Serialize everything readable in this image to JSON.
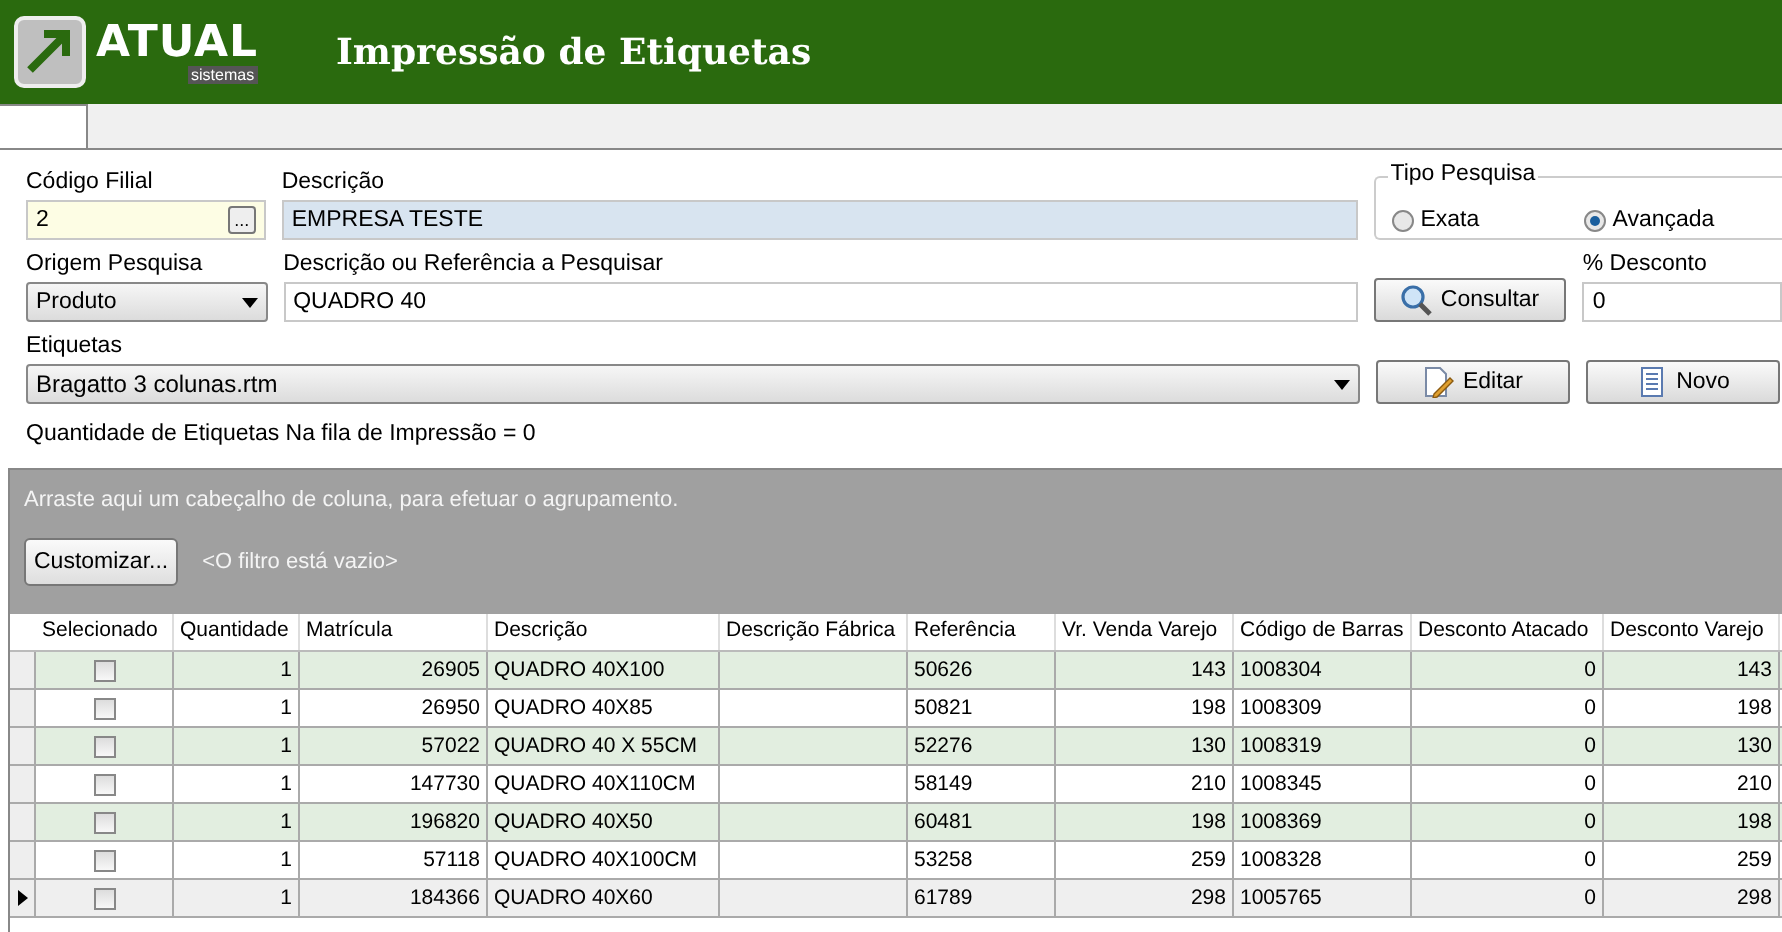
{
  "header": {
    "logo_text": "ATUAL",
    "logo_subtext": "sistemas",
    "title": "Impressão de Etiquetas"
  },
  "form": {
    "codigo_filial": {
      "label": "Código Filial",
      "value": "2",
      "button": "..."
    },
    "descricao": {
      "label": "Descrição",
      "value": "EMPRESA TESTE"
    },
    "tipo_pesquisa": {
      "label": "Tipo Pesquisa",
      "options": [
        {
          "label": "Exata",
          "selected": false
        },
        {
          "label": "Avançada",
          "selected": true
        }
      ]
    },
    "origem_pesquisa": {
      "label": "Origem Pesquisa",
      "value": "Produto"
    },
    "pesquisa": {
      "label": "Descrição ou Referência a Pesquisar",
      "value": "QUADRO 40"
    },
    "consultar_button": "Consultar",
    "desconto": {
      "label": "% Desconto",
      "value": "0"
    },
    "etiquetas": {
      "label": "Etiquetas",
      "value": "Bragatto 3 colunas.rtm"
    },
    "editar_button": "Editar",
    "novo_button": "Novo",
    "queue_text": "Quantidade de Etiquetas Na fila de Impressão = 0"
  },
  "grid": {
    "group_hint": "Arraste aqui um cabeçalho de coluna, para efetuar o agrupamento.",
    "customize_button": "Customizar...",
    "filter_text": "<O filtro está vazio>",
    "columns": [
      "Selecionado",
      "Quantidade",
      "Matrícula",
      "Descrição",
      "Descrição Fábrica",
      "Referência",
      "Vr. Venda Varejo",
      "Código de Barras",
      "Desconto Atacado",
      "Desconto Varejo"
    ],
    "rows": [
      {
        "selected": false,
        "checked": false,
        "cells": [
          "",
          "1",
          "26905",
          "QUADRO 40X100",
          "",
          "50626",
          "143",
          "1008304",
          "0",
          "143"
        ]
      },
      {
        "selected": false,
        "checked": false,
        "cells": [
          "",
          "1",
          "26950",
          "QUADRO 40X85",
          "",
          "50821",
          "198",
          "1008309",
          "0",
          "198"
        ]
      },
      {
        "selected": false,
        "checked": false,
        "cells": [
          "",
          "1",
          "57022",
          "QUADRO 40 X 55CM",
          "",
          "52276",
          "130",
          "1008319",
          "0",
          "130"
        ]
      },
      {
        "selected": false,
        "checked": false,
        "cells": [
          "",
          "1",
          "147730",
          "QUADRO 40X110CM",
          "",
          "58149",
          "210",
          "1008345",
          "0",
          "210"
        ]
      },
      {
        "selected": false,
        "checked": false,
        "cells": [
          "",
          "1",
          "196820",
          "QUADRO 40X50",
          "",
          "60481",
          "198",
          "1008369",
          "0",
          "198"
        ]
      },
      {
        "selected": false,
        "checked": false,
        "cells": [
          "",
          "1",
          "57118",
          "QUADRO 40X100CM",
          "",
          "53258",
          "259",
          "1008328",
          "0",
          "259"
        ]
      },
      {
        "selected": true,
        "checked": false,
        "cells": [
          "",
          "1",
          "184366",
          "QUADRO 40X60",
          "",
          "61789",
          "298",
          "1005765",
          "0",
          "298"
        ]
      }
    ]
  }
}
